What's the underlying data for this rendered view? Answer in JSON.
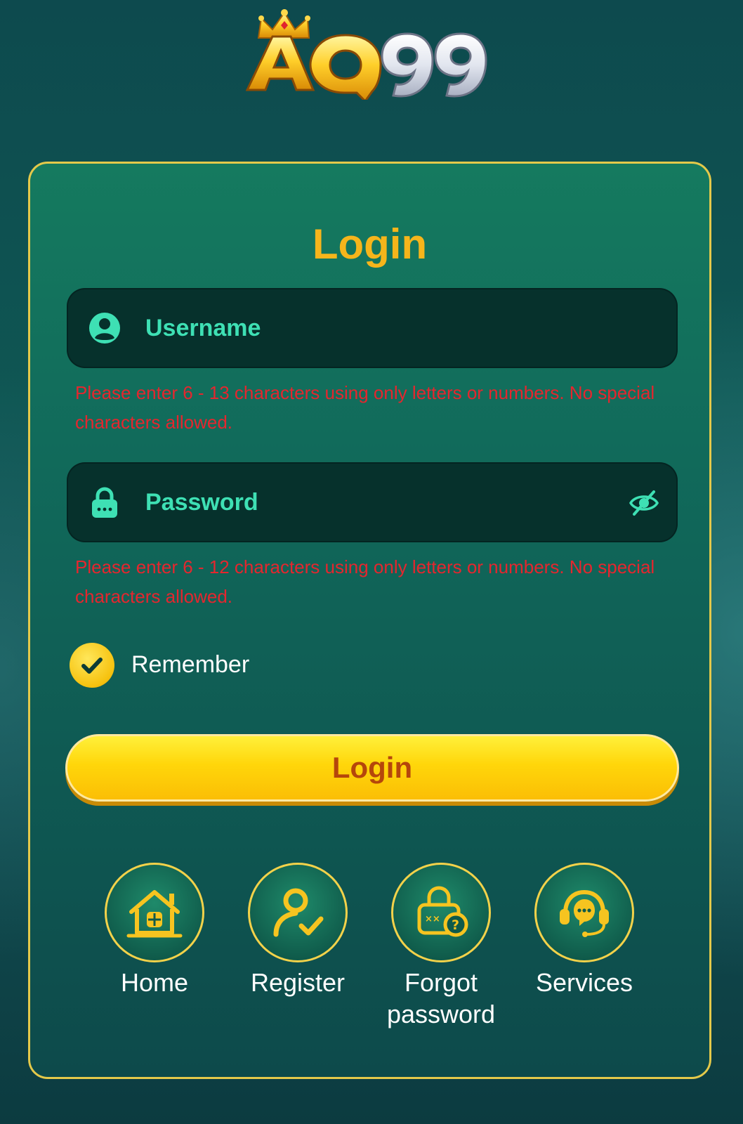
{
  "brand": {
    "logo_text": "AQ99"
  },
  "colors": {
    "accent_gold": "#f6b51b",
    "field_text": "#3ee0b4",
    "error_red": "#e5262e",
    "card_border": "#e4c94a"
  },
  "login_form": {
    "title": "Login",
    "username": {
      "placeholder": "Username",
      "value": "",
      "icon": "user-icon",
      "error": "Please enter 6 - 13 characters using only letters or numbers. No special characters allowed."
    },
    "password": {
      "placeholder": "Password",
      "value": "",
      "icon": "lock-icon",
      "toggle_icon": "eye-off-icon",
      "error": "Please enter 6 - 12 characters using only letters or numbers. No special characters allowed."
    },
    "remember": {
      "label": "Remember",
      "checked": true
    },
    "submit_label": "Login"
  },
  "nav": [
    {
      "label": "Home",
      "icon": "home-icon"
    },
    {
      "label": "Register",
      "icon": "register-user-icon"
    },
    {
      "label": "Forgot password",
      "icon": "forgot-password-lock-icon"
    },
    {
      "label": "Services",
      "icon": "support-headset-icon"
    }
  ]
}
